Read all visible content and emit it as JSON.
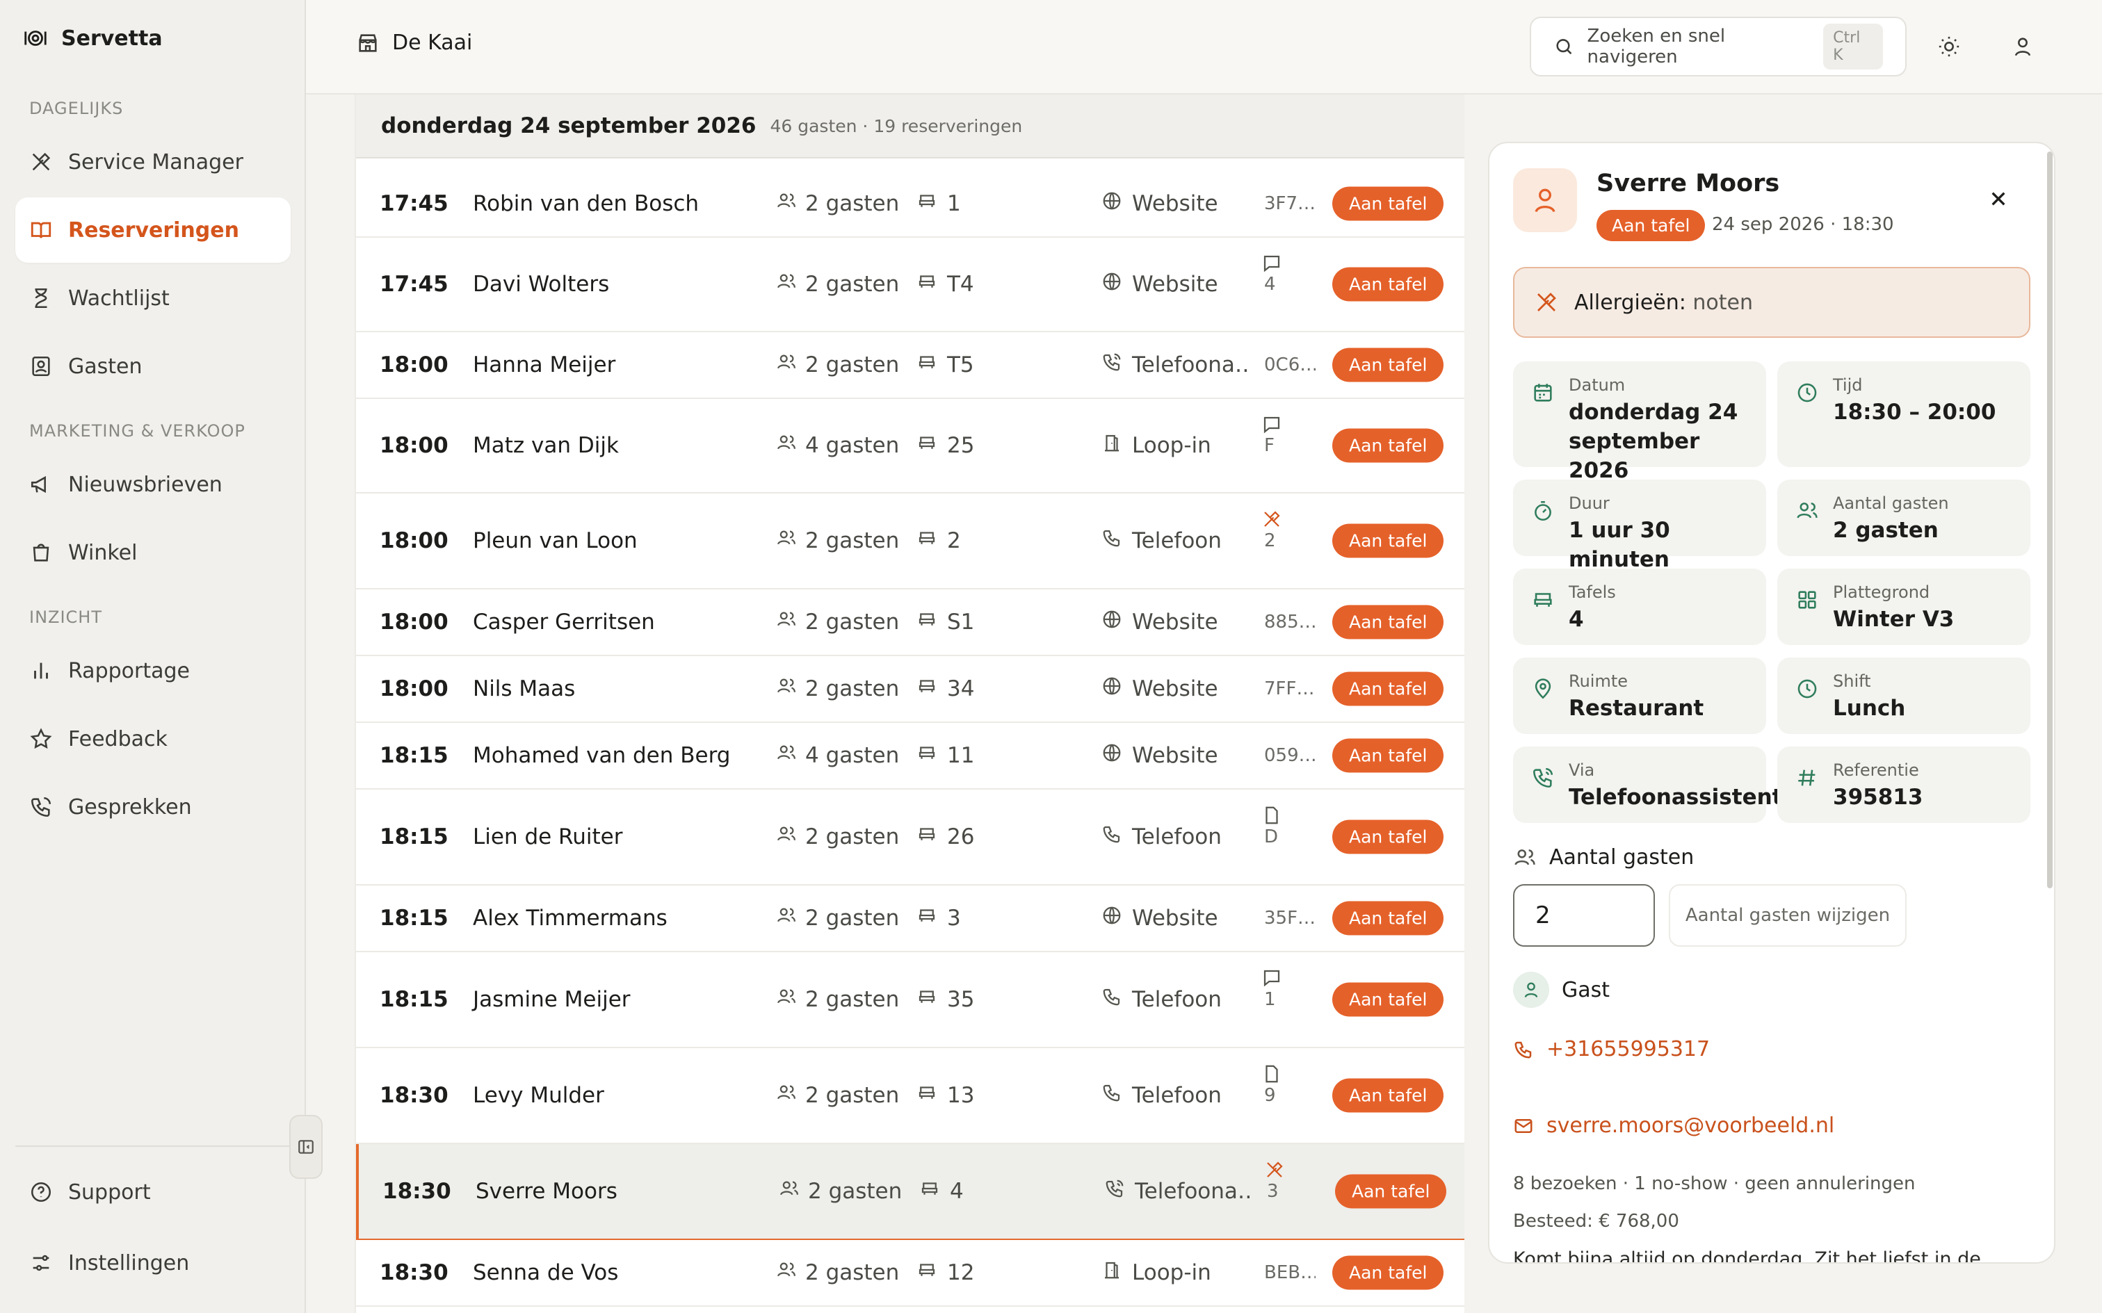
{
  "app": {
    "name": "Servetta"
  },
  "sidebar": {
    "sections": [
      {
        "title": "DAGELIJKS"
      },
      {
        "title": "MARKETING & VERKOOP"
      },
      {
        "title": "INZICHT"
      }
    ],
    "items": [
      {
        "label": "Service Manager",
        "icon": "service-icon"
      },
      {
        "label": "Reserveringen",
        "icon": "book-icon",
        "active": true
      },
      {
        "label": "Wachtlijst",
        "icon": "hourglass-icon"
      },
      {
        "label": "Gasten",
        "icon": "guests-icon"
      },
      {
        "label": "Nieuwsbrieven",
        "icon": "megaphone-icon"
      },
      {
        "label": "Winkel",
        "icon": "shop-icon"
      },
      {
        "label": "Rapportage",
        "icon": "chart-icon"
      },
      {
        "label": "Feedback",
        "icon": "star-icon"
      },
      {
        "label": "Gesprekken",
        "icon": "phone-icon"
      }
    ],
    "footer": [
      {
        "label": "Support",
        "icon": "help-icon"
      },
      {
        "label": "Instellingen",
        "icon": "settings-icon"
      }
    ]
  },
  "header": {
    "location": "De Kaai",
    "search_placeholder": "Zoeken en snel navigeren",
    "shortcut": "Ctrl K"
  },
  "list": {
    "date_title": "donderdag 24 september 2026",
    "date_sub": "46 gasten · 19 reserveringen",
    "rows": [
      {
        "time": "17:45",
        "name": "Robin van den Bosch",
        "guests": "2 gasten",
        "table": "1",
        "source": "Website",
        "source_icon": "globe",
        "ref": "3F7…",
        "note": "",
        "status": "Aan tafel"
      },
      {
        "time": "17:45",
        "name": "Davi Wolters",
        "guests": "2 gasten",
        "table": "T4",
        "source": "Website",
        "source_icon": "globe",
        "ref": "4",
        "note": "comment",
        "status": "Aan tafel"
      },
      {
        "time": "18:00",
        "name": "Hanna Meijer",
        "guests": "2 gasten",
        "table": "T5",
        "source": "Telefoona…",
        "source_icon": "phone-ai",
        "ref": "0C6…",
        "note": "",
        "status": "Aan tafel"
      },
      {
        "time": "18:00",
        "name": "Matz van Dijk",
        "guests": "4 gasten",
        "table": "25",
        "source": "Loop-in",
        "source_icon": "door",
        "ref": "F",
        "note": "comment",
        "status": "Aan tafel"
      },
      {
        "time": "18:00",
        "name": "Pleun van Loon",
        "guests": "2 gasten",
        "table": "2",
        "source": "Telefoon",
        "source_icon": "phone",
        "ref": "2",
        "note": "allergy",
        "status": "Aan tafel"
      },
      {
        "time": "18:00",
        "name": "Casper Gerritsen",
        "guests": "2 gasten",
        "table": "S1",
        "source": "Website",
        "source_icon": "globe",
        "ref": "885…",
        "note": "",
        "status": "Aan tafel"
      },
      {
        "time": "18:00",
        "name": "Nils Maas",
        "guests": "2 gasten",
        "table": "34",
        "source": "Website",
        "source_icon": "globe",
        "ref": "7FF…",
        "note": "",
        "status": "Aan tafel"
      },
      {
        "time": "18:15",
        "name": "Mohamed van den Berg",
        "guests": "4 gasten",
        "table": "11",
        "source": "Website",
        "source_icon": "globe",
        "ref": "059…",
        "note": "",
        "status": "Aan tafel"
      },
      {
        "time": "18:15",
        "name": "Lien de Ruiter",
        "guests": "2 gasten",
        "table": "26",
        "source": "Telefoon",
        "source_icon": "phone",
        "ref": "D",
        "note": "file",
        "status": "Aan tafel"
      },
      {
        "time": "18:15",
        "name": "Alex Timmermans",
        "guests": "2 gasten",
        "table": "3",
        "source": "Website",
        "source_icon": "globe",
        "ref": "35F…",
        "note": "",
        "status": "Aan tafel"
      },
      {
        "time": "18:15",
        "name": "Jasmine Meijer",
        "guests": "2 gasten",
        "table": "35",
        "source": "Telefoon",
        "source_icon": "phone",
        "ref": "1",
        "note": "comment",
        "status": "Aan tafel"
      },
      {
        "time": "18:30",
        "name": "Levy Mulder",
        "guests": "2 gasten",
        "table": "13",
        "source": "Telefoon",
        "source_icon": "phone",
        "ref": "9",
        "note": "file",
        "status": "Aan tafel"
      },
      {
        "time": "18:30",
        "name": "Sverre Moors",
        "guests": "2 gasten",
        "table": "4",
        "source": "Telefoona…",
        "source_icon": "phone-ai",
        "ref": "3",
        "note": "allergy",
        "status": "Aan tafel",
        "selected": true
      },
      {
        "time": "18:30",
        "name": "Senna de Vos",
        "guests": "2 gasten",
        "table": "12",
        "source": "Loop-in",
        "source_icon": "door",
        "ref": "BEB…",
        "note": "",
        "status": "Aan tafel"
      }
    ]
  },
  "detail": {
    "name": "Sverre Moors",
    "status": "Aan tafel",
    "when": "24 sep 2026 · 18:30",
    "allergy_label": "Allergieën:",
    "allergy_value": "noten",
    "tiles": [
      {
        "label": "Datum",
        "value": "donderdag 24 september 2026",
        "icon": "calendar-icon"
      },
      {
        "label": "Tijd",
        "value": "18:30 – 20:00",
        "icon": "clock-icon"
      },
      {
        "label": "Duur",
        "value": "1 uur 30 minuten",
        "icon": "timer-icon"
      },
      {
        "label": "Aantal gasten",
        "value": "2 gasten",
        "icon": "guests-icon"
      },
      {
        "label": "Tafels",
        "value": "4",
        "icon": "table-icon"
      },
      {
        "label": "Plattegrond",
        "value": "Winter V3",
        "icon": "grid-icon"
      },
      {
        "label": "Ruimte",
        "value": "Restaurant",
        "icon": "pin-icon"
      },
      {
        "label": "Shift",
        "value": "Lunch",
        "icon": "clock-icon"
      },
      {
        "label": "Via",
        "value": "Telefoonassistent",
        "icon": "phone-ai-icon"
      },
      {
        "label": "Referentie",
        "value": "395813",
        "icon": "hash-icon"
      }
    ],
    "guests_section": "Aantal gasten",
    "guests_value": "2",
    "guests_button": "Aantal gasten wijzigen",
    "guest_section": "Gast",
    "phone": "+31655995317",
    "email": "sverre.moors@voorbeeld.nl",
    "stats": "8 bezoeken · 1 no-show · geen annuleringen",
    "spent": "Besteed: € 768,00",
    "note_preview": "Komt bijna altijd op donderdag. Zit het liefst in de"
  },
  "colors": {
    "accent": "#e5612a",
    "accent_text": "#d4551c",
    "icon_green": "#2f7d5b"
  }
}
